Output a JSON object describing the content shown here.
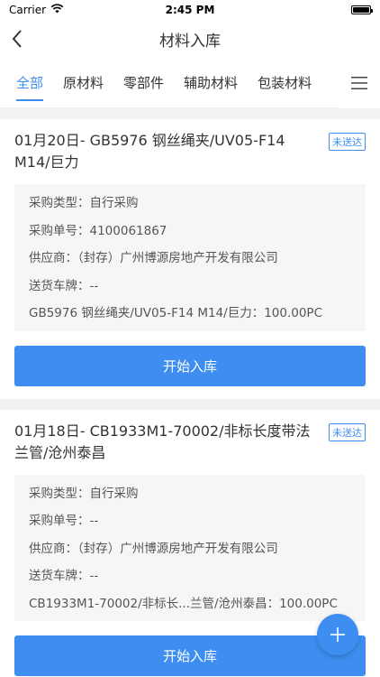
{
  "status_bar": {
    "carrier": "Carrier",
    "time": "2:45 PM"
  },
  "nav": {
    "title": "材料入库"
  },
  "tabs": [
    {
      "label": "全部",
      "active": true
    },
    {
      "label": "原材料",
      "active": false
    },
    {
      "label": "零部件",
      "active": false
    },
    {
      "label": "辅助材料",
      "active": false
    },
    {
      "label": "包装材料",
      "active": false
    }
  ],
  "cards": [
    {
      "title": "01月20日- GB5976 钢丝绳夹/UV05-F14 M14/巨力",
      "badge": "未送达",
      "purchase_type": "采购类型：自行采购",
      "purchase_no": "采购单号：4100061867",
      "supplier": "供应商：（封存）广州博源房地产开发有限公司",
      "plate": "送货车牌：--",
      "item": "GB5976 钢丝绳夹/UV05-F14 M14/巨力：100.00PC",
      "button": "开始入库"
    },
    {
      "title": "01月18日- CB1933M1-70002/非标长度带法兰管/沧州泰昌",
      "badge": "未送达",
      "purchase_type": "采购类型：自行采购",
      "purchase_no": "采购单号：--",
      "supplier": "供应商：（封存）广州博源房地产开发有限公司",
      "plate": "送货车牌：--",
      "item": "CB1933M1-70002/非标长...兰管/沧州泰昌：100.00PC",
      "button": "开始入库"
    }
  ],
  "colors": {
    "accent": "#3d8ef0",
    "background": "#f2f2f2"
  }
}
